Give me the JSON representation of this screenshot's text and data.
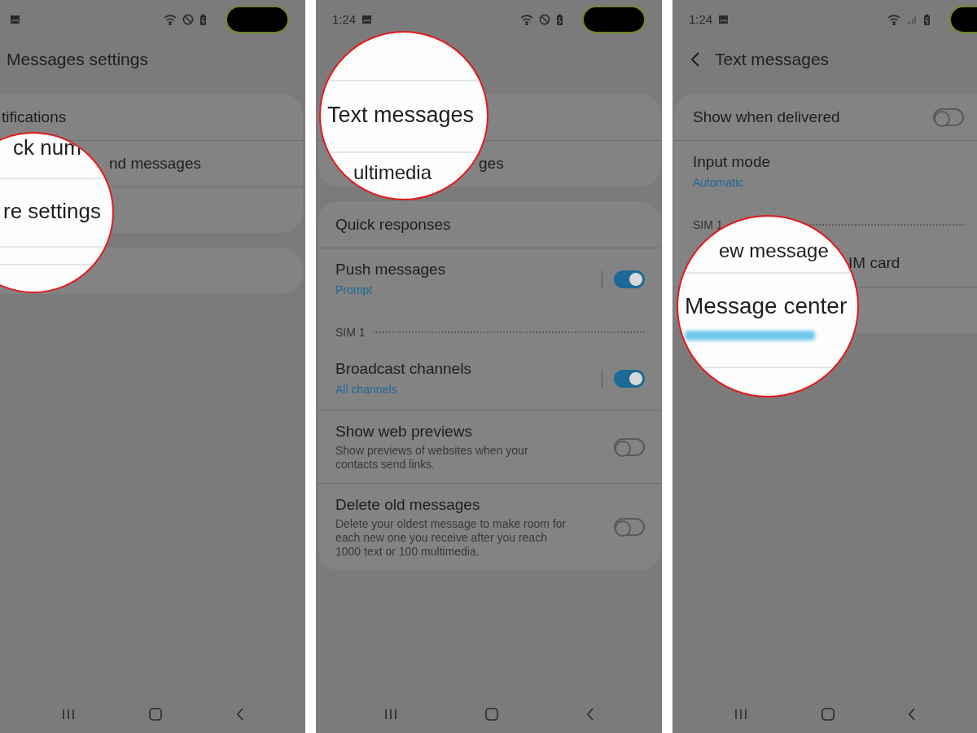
{
  "panels": [
    {
      "status": {
        "icons": [
          {
            "kind": "image"
          },
          {
            "kind": "wifi"
          },
          {
            "kind": "dnd"
          },
          {
            "kind": "battery"
          }
        ]
      },
      "header": {
        "title": "Messages settings"
      },
      "cards": [
        {
          "rows": [
            {
              "kind": "item",
              "label": "tifications"
            },
            {
              "kind": "partial",
              "label": "nd messages"
            },
            {
              "kind": "covered"
            }
          ]
        },
        {
          "rows": [
            {
              "kind": "covered"
            }
          ]
        }
      ],
      "lens": [
        "ck num",
        "re settings"
      ]
    },
    {
      "status": {
        "time": "1:24",
        "icons": [
          {
            "kind": "image"
          },
          {
            "kind": "wifi"
          },
          {
            "kind": "dnd"
          },
          {
            "kind": "battery"
          }
        ]
      },
      "cards": [
        {
          "rows": [
            {
              "kind": "covered"
            },
            {
              "kind": "partial",
              "label": "ges"
            }
          ]
        },
        {
          "rows": [
            {
              "kind": "item",
              "label": "Quick responses"
            },
            {
              "kind": "item",
              "label": "Push messages",
              "sub": "Prompt",
              "toggle": {
                "on": true,
                "divider": true
              }
            },
            {
              "kind": "header",
              "label": "SIM 1"
            },
            {
              "kind": "item",
              "label": "Broadcast channels",
              "sub": "All channels",
              "toggle": {
                "on": true,
                "divider": true
              }
            },
            {
              "kind": "item",
              "label": "Show web previews",
              "description": "Show previews of websites when your contacts send links.",
              "toggle": {
                "on": false,
                "divider": false
              }
            },
            {
              "kind": "item",
              "label": "Delete old messages",
              "description": "Delete your oldest message to make room for each new one you receive after you reach 1000 text or 100 multimedia.",
              "toggle": {
                "on": false,
                "divider": false
              }
            }
          ]
        }
      ],
      "lens": [
        "Text messages",
        "ultimedia"
      ]
    },
    {
      "status": {
        "time": "1:24",
        "icons": [
          {
            "kind": "image"
          },
          {
            "kind": "wifi"
          },
          {
            "kind": "signal"
          },
          {
            "kind": "battery"
          }
        ]
      },
      "header": {
        "back": true,
        "title": "Text messages"
      },
      "cards": [
        {
          "rows": [
            {
              "kind": "item",
              "label": "Show when delivered",
              "toggle": {
                "on": false,
                "divider": false
              }
            },
            {
              "kind": "item",
              "label": "Input mode",
              "sub": "Automatic"
            },
            {
              "kind": "header",
              "label": "SIM 1"
            },
            {
              "kind": "partial",
              "label": "IM card"
            },
            {
              "kind": "covered"
            }
          ]
        }
      ],
      "lens": [
        "ew message",
        "Message center"
      ]
    }
  ]
}
